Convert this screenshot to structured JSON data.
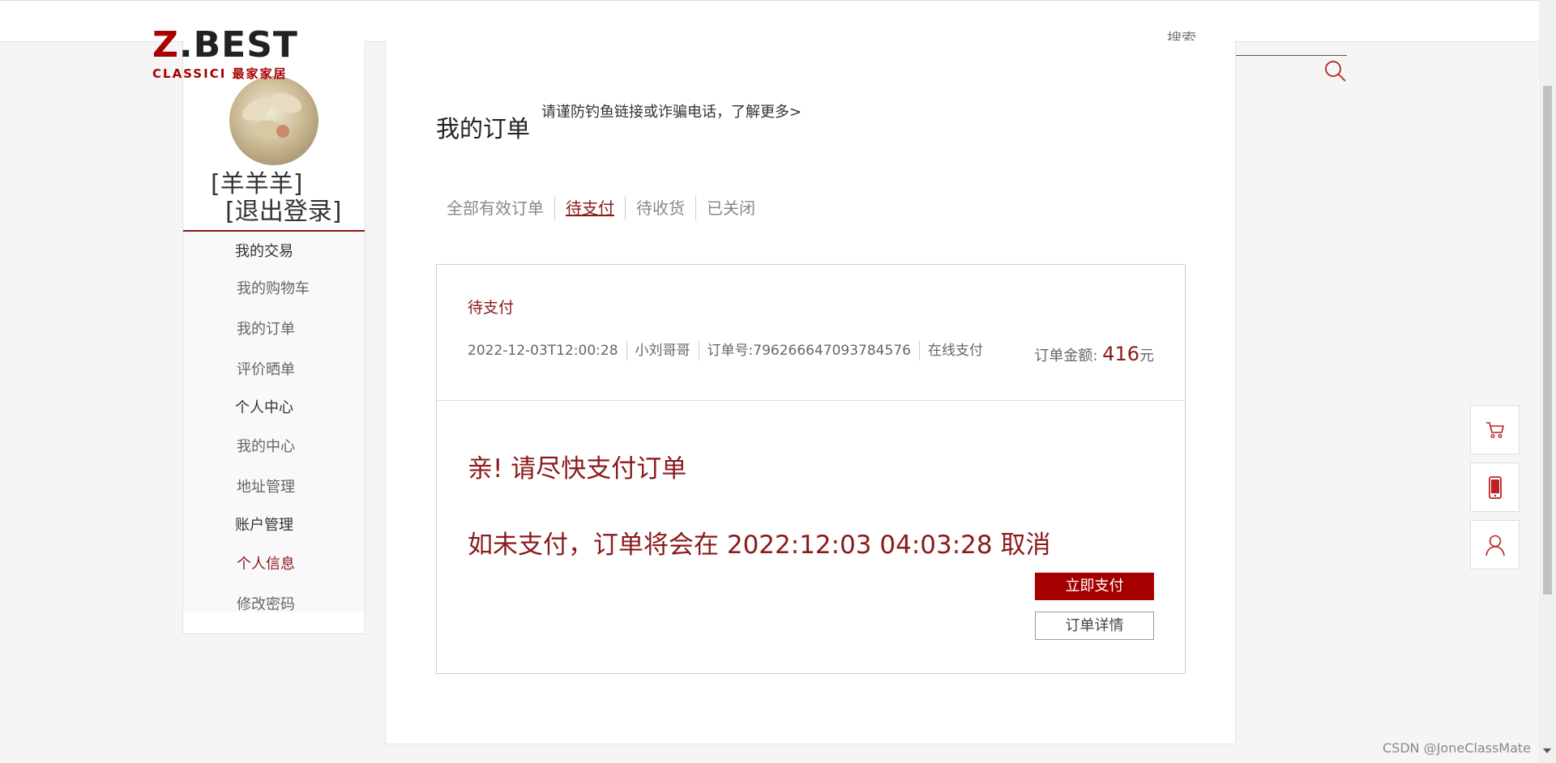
{
  "brand": {
    "name_prefix": "Z",
    "name_rest": ".BEST",
    "subtitle": "CLASSICI 最家家居"
  },
  "search": {
    "placeholder": "搜索"
  },
  "user": {
    "name": "[羊羊羊]",
    "logout": "[退出登录]"
  },
  "sidebar": {
    "sections": [
      {
        "title": "我的交易",
        "items": [
          "我的购物车",
          "我的订单",
          "评价晒单"
        ]
      },
      {
        "title": "个人中心",
        "items": [
          "我的中心",
          "地址管理"
        ]
      },
      {
        "title": "账户管理",
        "items": [
          "个人信息",
          "修改密码"
        ]
      }
    ],
    "active_item": "个人信息"
  },
  "main": {
    "title": "我的订单",
    "notice": "请谨防钓鱼链接或诈骗电话，了解更多>",
    "tabs": [
      "全部有效订单",
      "待支付",
      "待收货",
      "已关闭"
    ],
    "active_tab": "待支付"
  },
  "order": {
    "status": "待支付",
    "time": "2022-12-03T12:00:28",
    "recipient": "小刘哥哥",
    "order_no": "订单号:796266647093784576",
    "payment": "在线支付",
    "amount_label": "订单金额:",
    "amount": "416",
    "currency": "元",
    "prompt": "亲! 请尽快支付订单",
    "cancel_notice": "如未支付，订单将会在 2022:12:03 04:03:28 取消",
    "pay_button": "立即支付",
    "detail_button": "订单详情"
  },
  "float_buttons": [
    "cart-icon",
    "phone-icon",
    "user-icon"
  ],
  "watermark": "CSDN @JoneClassMate",
  "colors": {
    "accent": "#8b1a1a",
    "pay_button": "#a50000"
  }
}
